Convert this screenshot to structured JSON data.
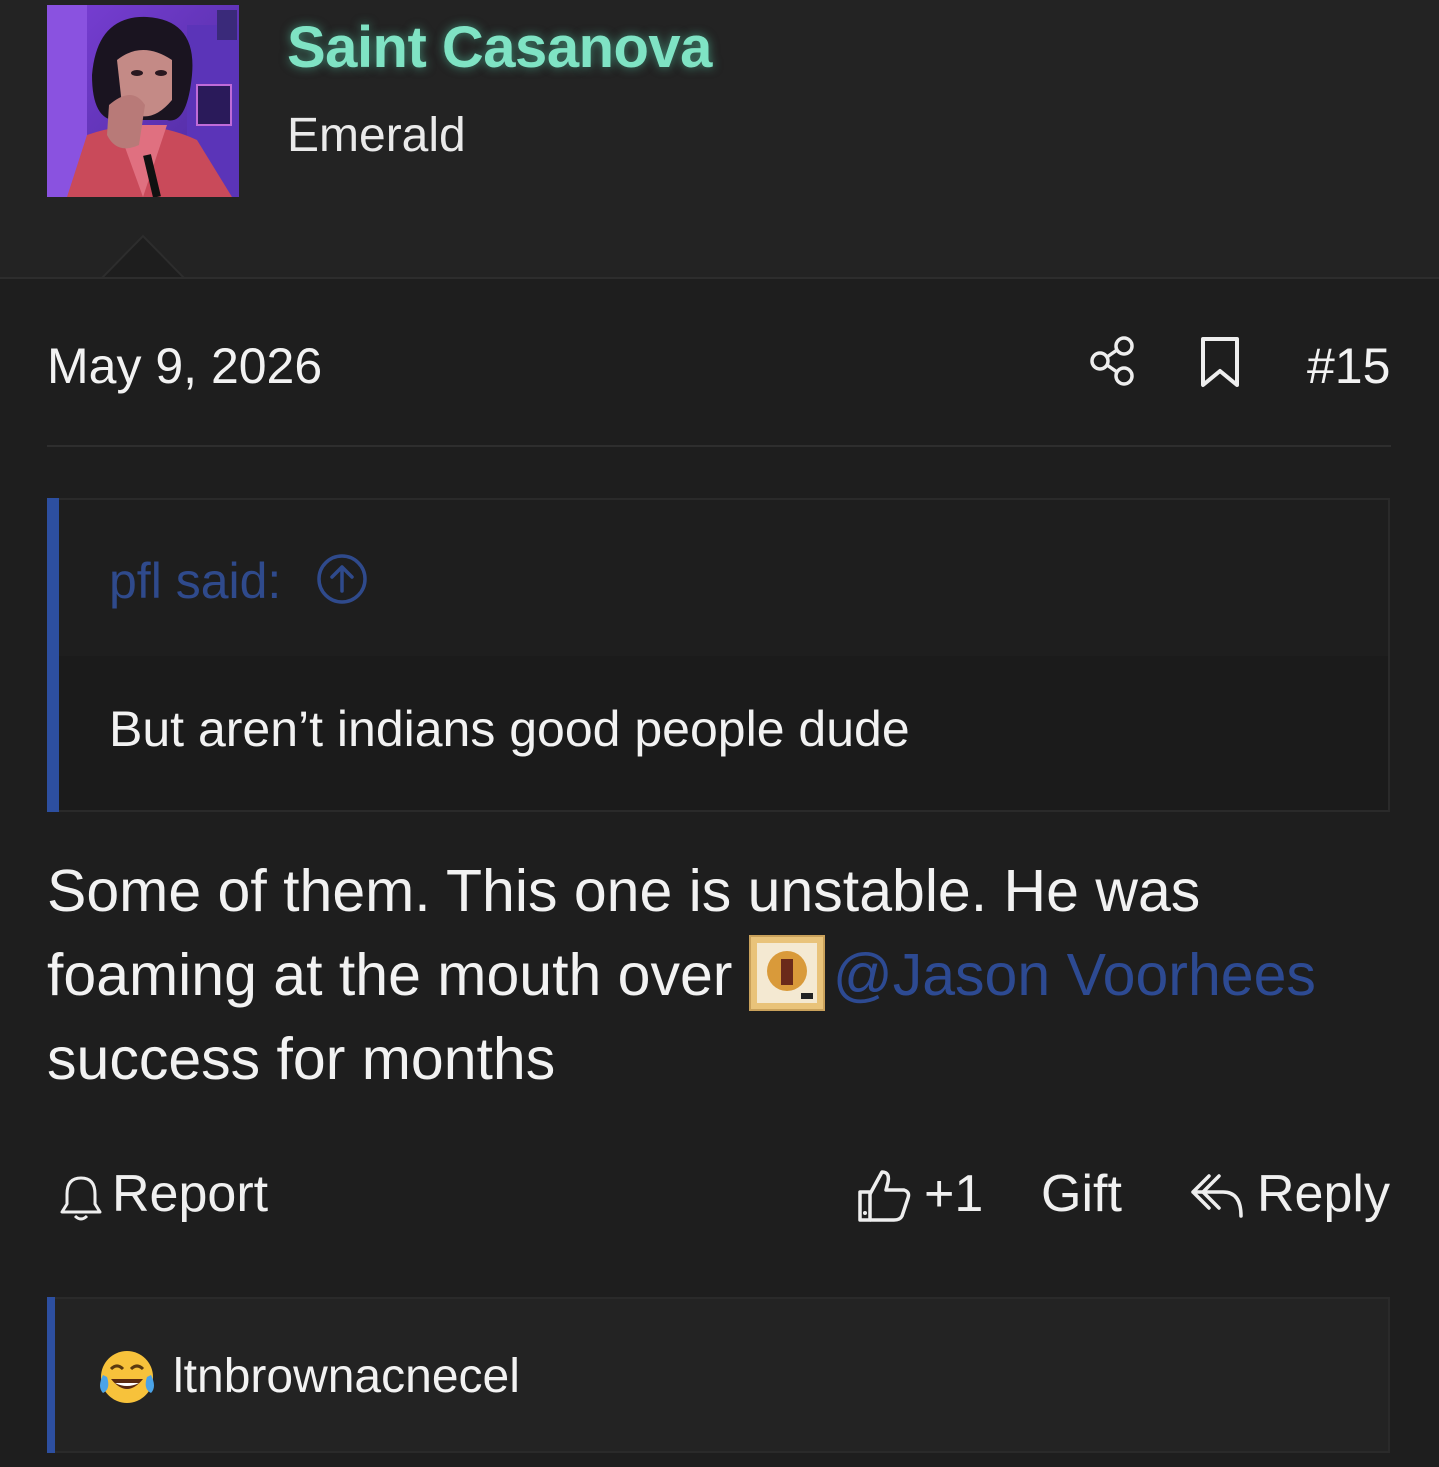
{
  "author": {
    "username": "Saint Casanova",
    "user_title": "Emerald",
    "avatar_icon": "avatar-image"
  },
  "post": {
    "date": "May 9, 2026",
    "number": "#15",
    "share_icon": "share-icon",
    "bookmark_icon": "bookmark-icon"
  },
  "quote": {
    "author_label": "pfl said:",
    "jump_icon": "arrow-up-circle-icon",
    "text": "But aren’t indians good people dude"
  },
  "message": {
    "text_part1": "Some of them. This one is unstable. He was foaming at the mouth over ",
    "mention": "@Jason Voorhees",
    "text_part2": " success for months"
  },
  "actions": {
    "report_label": "Report",
    "like_label": "+1",
    "gift_label": "Gift",
    "reply_label": "Reply"
  },
  "reactions": {
    "emoji": "tears-of-joy-emoji",
    "user": "ltnbrownacnecel"
  },
  "colors": {
    "background": "#1e1e1e",
    "username": "#7fe3c4",
    "accent_blue": "#2d4fa0",
    "mention": "#2d4a92"
  }
}
